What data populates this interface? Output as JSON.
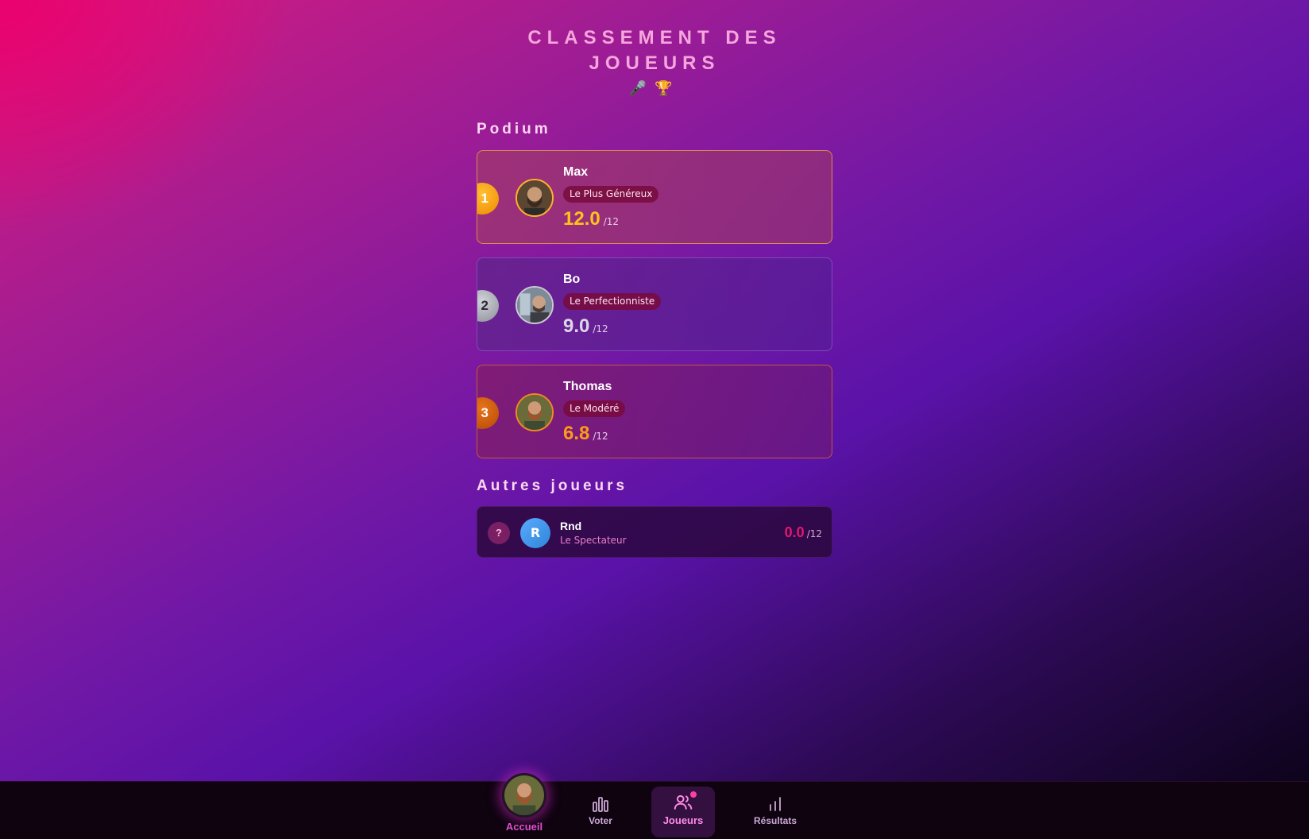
{
  "header": {
    "title": "CLASSEMENT DES JOUEURS",
    "icons": [
      "microphone-icon",
      "trophy-icon"
    ],
    "icon_glyphs": [
      "🎤",
      "🏆"
    ]
  },
  "podium": {
    "label": "Podium",
    "players": [
      {
        "rank": "1",
        "name": "Max",
        "badge": "Le Plus Généreux",
        "score": "12.0",
        "max": "/12"
      },
      {
        "rank": "2",
        "name": "Bo",
        "badge": "Le Perfectionniste",
        "score": "9.0",
        "max": "/12"
      },
      {
        "rank": "3",
        "name": "Thomas",
        "badge": "Le Modéré",
        "score": "6.8",
        "max": "/12"
      }
    ]
  },
  "others": {
    "label": "Autres joueurs",
    "players": [
      {
        "rank": "?",
        "initial": "R",
        "name": "Rnd",
        "title": "Le Spectateur",
        "score": "0.0",
        "max": "/12"
      }
    ]
  },
  "nav": {
    "home": "Accueil",
    "vote": "Voter",
    "players": "Joueurs",
    "results": "Résultats",
    "active": "players"
  },
  "colors": {
    "gold": "#ffc21c",
    "silver": "#dcd6e6",
    "bronze": "#ff9a18",
    "accent": "#e0186e",
    "nav_active": "#ff8be5"
  }
}
